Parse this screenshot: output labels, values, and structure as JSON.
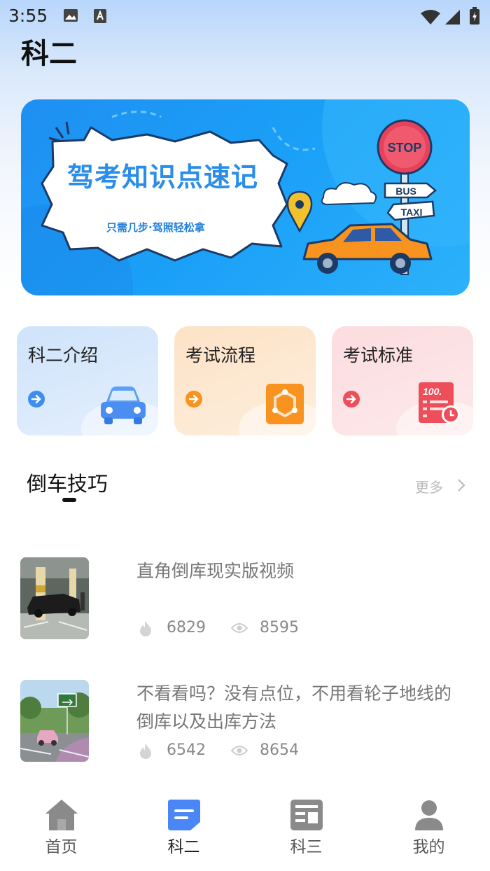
{
  "status_bar": {
    "time": "3:55"
  },
  "header": {
    "title": "科二"
  },
  "banner": {
    "title": "驾考知识点速记",
    "subtitle": "只需几步·驾照轻松拿",
    "sign_stop": "STOP",
    "sign_bus": "BUS",
    "sign_taxi": "TAXI"
  },
  "quick_cards": [
    {
      "label": "科二介绍",
      "icon": "car-icon",
      "accent": "#3d8ef0"
    },
    {
      "label": "考试流程",
      "icon": "process-icon",
      "accent": "#f7931e"
    },
    {
      "label": "考试标准",
      "icon": "score-sheet-icon",
      "accent": "#ee4d5a"
    }
  ],
  "section": {
    "title": "倒车技巧",
    "more_label": "更多"
  },
  "list": [
    {
      "title": "直角倒库现实版视频",
      "hot": "6829",
      "views": "8595"
    },
    {
      "title": "不看看吗？没有点位，不用看轮子地线的倒库以及出库方法",
      "hot": "6542",
      "views": "8654"
    }
  ],
  "bottom_nav": [
    {
      "label": "首页",
      "icon": "home-icon",
      "active": false
    },
    {
      "label": "科二",
      "icon": "document-icon",
      "active": true
    },
    {
      "label": "科三",
      "icon": "newspaper-icon",
      "active": false
    },
    {
      "label": "我的",
      "icon": "user-icon",
      "active": false
    }
  ],
  "colors": {
    "accent": "#4a86f5",
    "banner": "#1f8ff2"
  }
}
